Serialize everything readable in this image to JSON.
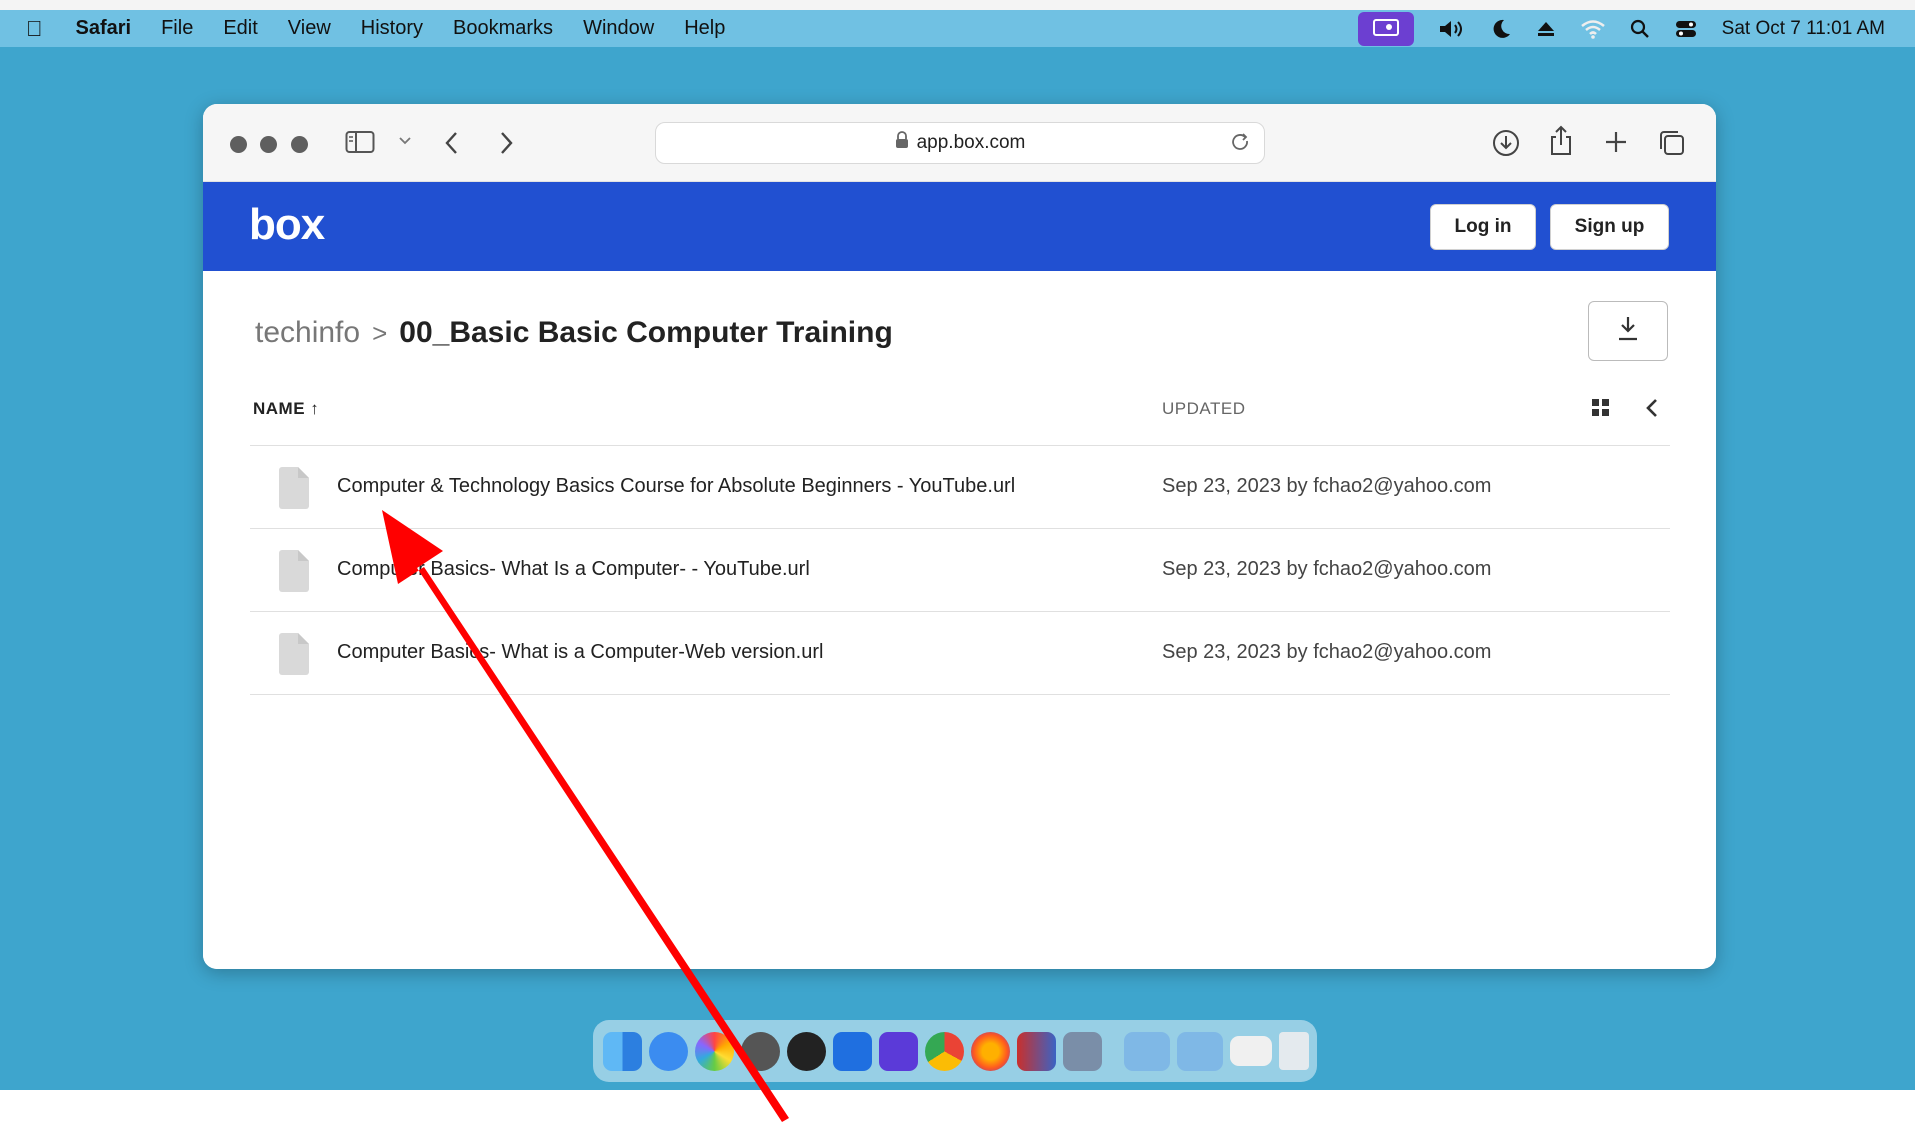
{
  "menubar": {
    "app_name": "Safari",
    "items": [
      "File",
      "Edit",
      "View",
      "History",
      "Bookmarks",
      "Window",
      "Help"
    ],
    "clock": "Sat Oct 7  11:01 AM"
  },
  "browser": {
    "url": "app.box.com"
  },
  "box": {
    "logo": "box",
    "login_label": "Log in",
    "signup_label": "Sign up",
    "breadcrumb": {
      "root": "techinfo",
      "separator": ">",
      "current": "00_Basic Basic Computer Training"
    },
    "columns": {
      "name": "NAME ↑",
      "updated": "UPDATED"
    },
    "files": [
      {
        "name": "Computer & Technology Basics Course for Absolute Beginners - YouTube.url",
        "updated": "Sep 23, 2023 by fchao2@yahoo.com"
      },
      {
        "name": "Computer Basics- What Is a Computer- - YouTube.url",
        "updated": "Sep 23, 2023 by fchao2@yahoo.com"
      },
      {
        "name": "Computer Basics- What is a Computer-Web version.url",
        "updated": "Sep 23, 2023 by fchao2@yahoo.com"
      }
    ]
  },
  "colors": {
    "desktop": "#3ea5cd",
    "box_blue": "#2150d1",
    "arrow": "#ff0000"
  },
  "dock": {
    "apps": [
      "finder-icon",
      "safari-icon",
      "photos-icon",
      "launchpad-icon",
      "speedtest-icon",
      "teamviewer-icon",
      "imovie-icon",
      "chrome-icon",
      "firefox-icon",
      "parallels-icon",
      "virtualbox-icon",
      "downloads-folder-icon",
      "applications-folder-icon",
      "preview-icon",
      "trash-icon"
    ]
  }
}
